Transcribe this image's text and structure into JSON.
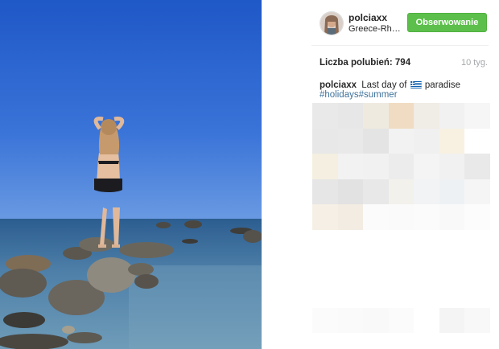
{
  "post": {
    "username": "polciaxx",
    "location": "Greece-Rh…",
    "follow_label": "Obserwowanie",
    "likes_text": "Liczba polubień: 794",
    "time_ago": "10 tyg.",
    "caption_user": "polciaxx",
    "caption_before_flag": "Last day of",
    "caption_after_flag": "paradise",
    "hashtags": [
      "#holidays",
      "#summer"
    ]
  },
  "colors": {
    "follow_button": "#5cbf4c",
    "hashtag": "#3f729b",
    "sky": "#2d62c9"
  },
  "icons": {
    "flag": "greece-flag-icon"
  },
  "placeholder_tiles": [
    "#e9e9e9",
    "#e7e7e7",
    "#efeae0",
    "#f0dcc2",
    "#f0ece6",
    "#f1f1f1",
    "#f6f6f6",
    "#e8e8e8",
    "#e9e9e9",
    "#e4e4e4",
    "#f2f2f2",
    "#f0f0f0",
    "#f8f1e2",
    "#ffffff",
    "#f4efe0",
    "#f2f2f2",
    "#f1f1f1",
    "#ececec",
    "#f4f4f4",
    "#f1f1f1",
    "#e9e9e9",
    "#e6e6e6",
    "#e2e2e2",
    "#e8e8e8",
    "#f3f1ec",
    "#f2f3f4",
    "#eef1f4",
    "#f5f5f5",
    "#f5efe5",
    "#f2ece2",
    "#fbfbfb",
    "#fafafa",
    "#fbfbfb",
    "#f9f9f9",
    "#fcfcfc"
  ],
  "placeholder_tiles_bottom": [
    "#fbfbfb",
    "#fafafa",
    "#f9f9f9",
    "#fbfbfb",
    "#ffffff",
    "#f4f4f4",
    "#f8f8f8"
  ]
}
